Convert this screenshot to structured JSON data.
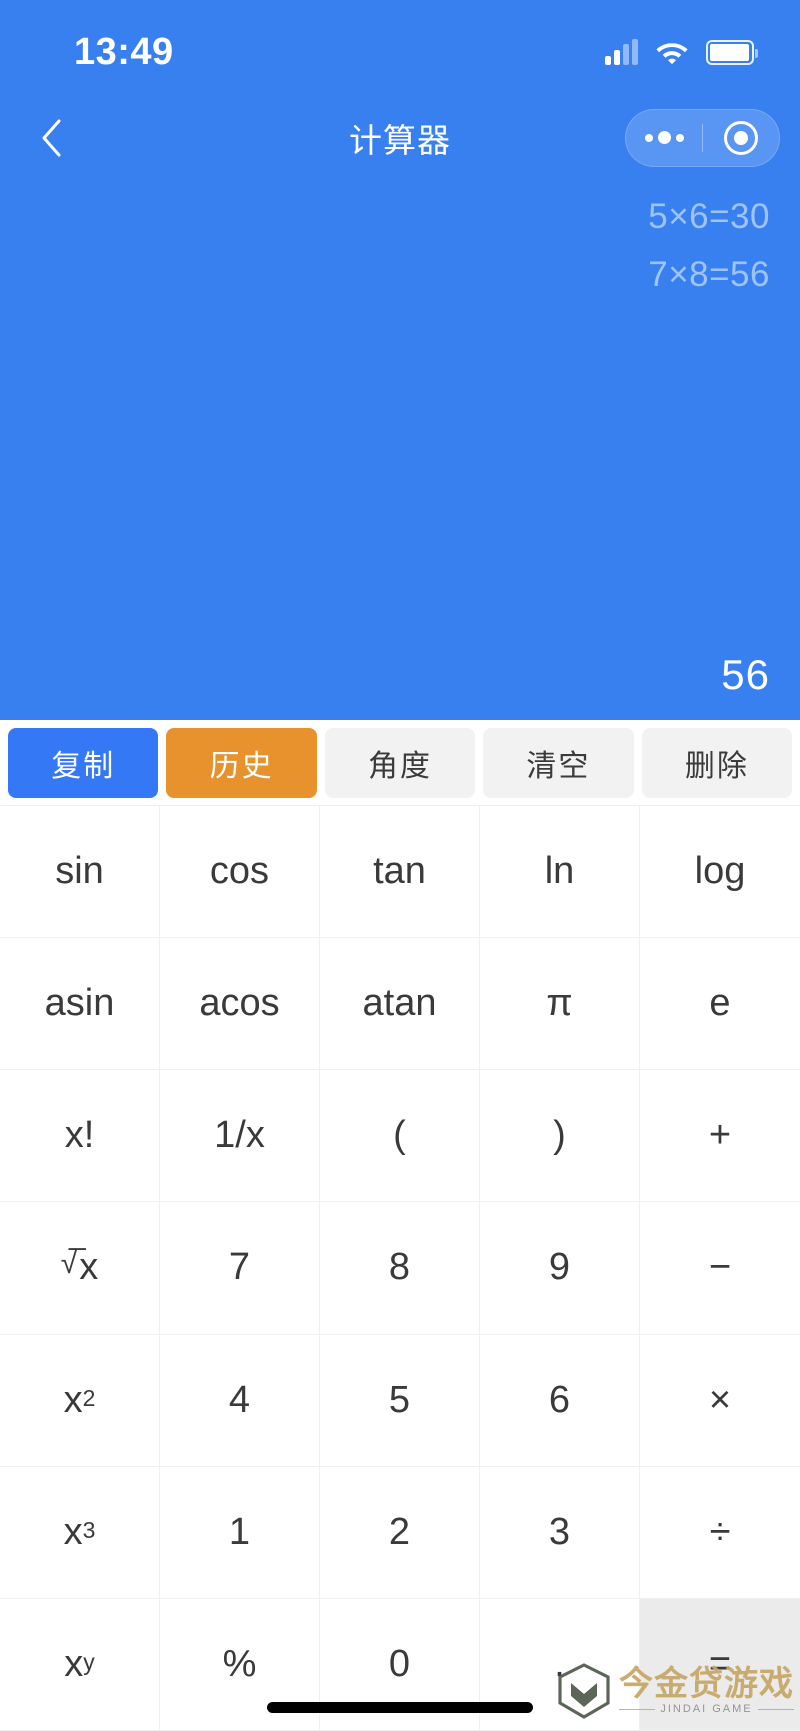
{
  "statusbar": {
    "time": "13:49",
    "signal_icon": "cellular-signal-icon",
    "wifi_icon": "wifi-icon",
    "battery_icon": "battery-icon"
  },
  "navbar": {
    "title": "计算器",
    "back_icon": "back-chevron-icon",
    "menu_icon": "more-dots-icon",
    "close_icon": "target-circle-icon"
  },
  "display": {
    "history": [
      "5×6=30",
      "7×8=56"
    ],
    "result": "56",
    "background_color": "#3880F0"
  },
  "actions": [
    {
      "label": "复制",
      "style": "primary",
      "color": "#3478F6"
    },
    {
      "label": "历史",
      "style": "warn",
      "color": "#E8922E"
    },
    {
      "label": "角度",
      "style": "plain",
      "color": "#F2F2F2"
    },
    {
      "label": "清空",
      "style": "plain",
      "color": "#F2F2F2"
    },
    {
      "label": "删除",
      "style": "plain",
      "color": "#F2F2F2"
    }
  ],
  "keypad": {
    "rows": [
      [
        {
          "label": "sin",
          "name": "key-sin"
        },
        {
          "label": "cos",
          "name": "key-cos"
        },
        {
          "label": "tan",
          "name": "key-tan"
        },
        {
          "label": "ln",
          "name": "key-ln"
        },
        {
          "label": "log",
          "name": "key-log"
        }
      ],
      [
        {
          "label": "asin",
          "name": "key-asin"
        },
        {
          "label": "acos",
          "name": "key-acos"
        },
        {
          "label": "atan",
          "name": "key-atan"
        },
        {
          "label": "π",
          "name": "key-pi"
        },
        {
          "label": "e",
          "name": "key-e"
        }
      ],
      [
        {
          "label": "x!",
          "name": "key-factorial"
        },
        {
          "label": "1/x",
          "name": "key-reciprocal"
        },
        {
          "label": "(",
          "name": "key-paren-open"
        },
        {
          "label": ")",
          "name": "key-paren-close"
        },
        {
          "label": "+",
          "name": "key-plus"
        }
      ],
      [
        {
          "label": "√x",
          "name": "key-sqrt",
          "base": "√",
          "sup": "",
          "radical": true
        },
        {
          "label": "7",
          "name": "key-7"
        },
        {
          "label": "8",
          "name": "key-8"
        },
        {
          "label": "9",
          "name": "key-9"
        },
        {
          "label": "−",
          "name": "key-minus"
        }
      ],
      [
        {
          "label": "x2",
          "name": "key-square",
          "base": "x",
          "sup": "2"
        },
        {
          "label": "4",
          "name": "key-4"
        },
        {
          "label": "5",
          "name": "key-5"
        },
        {
          "label": "6",
          "name": "key-6"
        },
        {
          "label": "×",
          "name": "key-multiply"
        }
      ],
      [
        {
          "label": "x3",
          "name": "key-cube",
          "base": "x",
          "sup": "3"
        },
        {
          "label": "1",
          "name": "key-1"
        },
        {
          "label": "2",
          "name": "key-2"
        },
        {
          "label": "3",
          "name": "key-3"
        },
        {
          "label": "÷",
          "name": "key-divide"
        }
      ],
      [
        {
          "label": "xy",
          "name": "key-power",
          "base": "x",
          "sup": "y"
        },
        {
          "label": "%",
          "name": "key-percent"
        },
        {
          "label": "0",
          "name": "key-0"
        },
        {
          "label": ".",
          "name": "key-decimal"
        },
        {
          "label": "=",
          "name": "key-equals",
          "equals": true
        }
      ]
    ]
  },
  "watermark": {
    "title": "今金贷游戏",
    "subtitle": "JINDAI GAME",
    "title_color": "#C6A664"
  }
}
